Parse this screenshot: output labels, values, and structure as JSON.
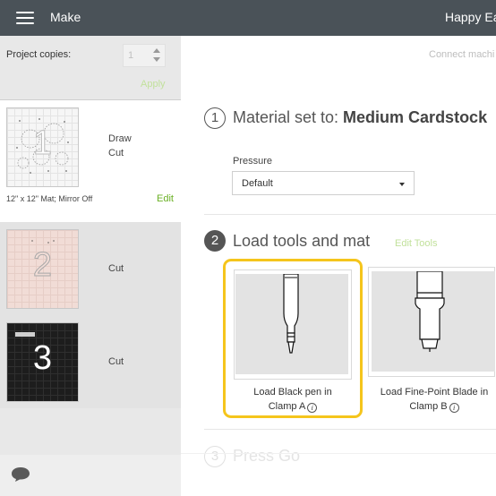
{
  "header": {
    "app_title": "Make",
    "project_name": "Happy Ea"
  },
  "sidebar": {
    "copies": {
      "label": "Project copies:",
      "value": "1",
      "apply_label": "Apply"
    },
    "mats": [
      {
        "number": "1",
        "operations": [
          "Draw",
          "Cut"
        ],
        "caption": "12\" x 12\" Mat; Mirror Off",
        "edit_label": "Edit",
        "selected": true
      },
      {
        "number": "2",
        "operations": [
          "Cut"
        ],
        "selected": false
      },
      {
        "number": "3",
        "operations": [
          "Cut"
        ],
        "selected": false
      }
    ]
  },
  "main": {
    "connect_label": "Connect machi",
    "step1": {
      "number": "1",
      "prefix": "Material set to: ",
      "material": "Medium Cardstock",
      "pressure_label": "Pressure",
      "pressure_value": "Default"
    },
    "step2": {
      "number": "2",
      "title": "Load tools and mat",
      "edit_tools_label": "Edit Tools",
      "tools": [
        {
          "line1": "Load Black pen in",
          "line2": "Clamp A",
          "highlighted": true
        },
        {
          "line1": "Load Fine-Point Blade in",
          "line2": "Clamp B",
          "highlighted": false
        }
      ]
    },
    "step3": {
      "number": "3",
      "title": "Press Go"
    }
  },
  "colors": {
    "topbar": "#4a5258",
    "accent_green": "#6ab024",
    "highlight_yellow": "#f5c51c",
    "sidebar_bg": "#e8e8e8"
  },
  "icons": {
    "menu": "hamburger-icon",
    "info": "info-icon",
    "chat": "chat-bubble-icon",
    "dropdown": "chevron-down-icon"
  }
}
